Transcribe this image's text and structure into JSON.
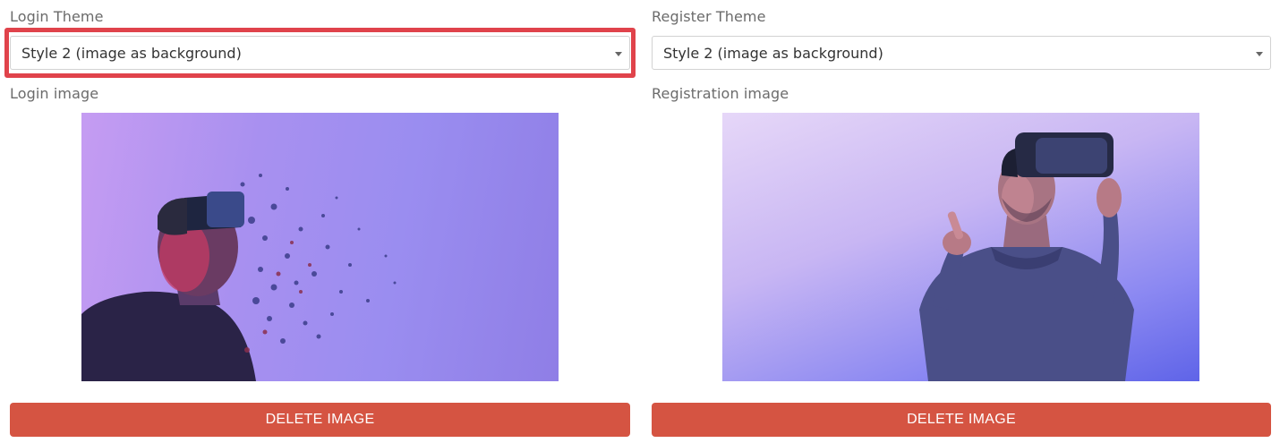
{
  "login": {
    "theme_label": "Login Theme",
    "theme_value": "Style 2 (image as background)",
    "image_label": "Login image",
    "delete_label": "DELETE IMAGE"
  },
  "register": {
    "theme_label": "Register Theme",
    "theme_value": "Style 2 (image as background)",
    "image_label": "Registration image",
    "delete_label": "DELETE IMAGE"
  },
  "colors": {
    "highlight": "#e0434b",
    "delete_button": "#d55442"
  }
}
